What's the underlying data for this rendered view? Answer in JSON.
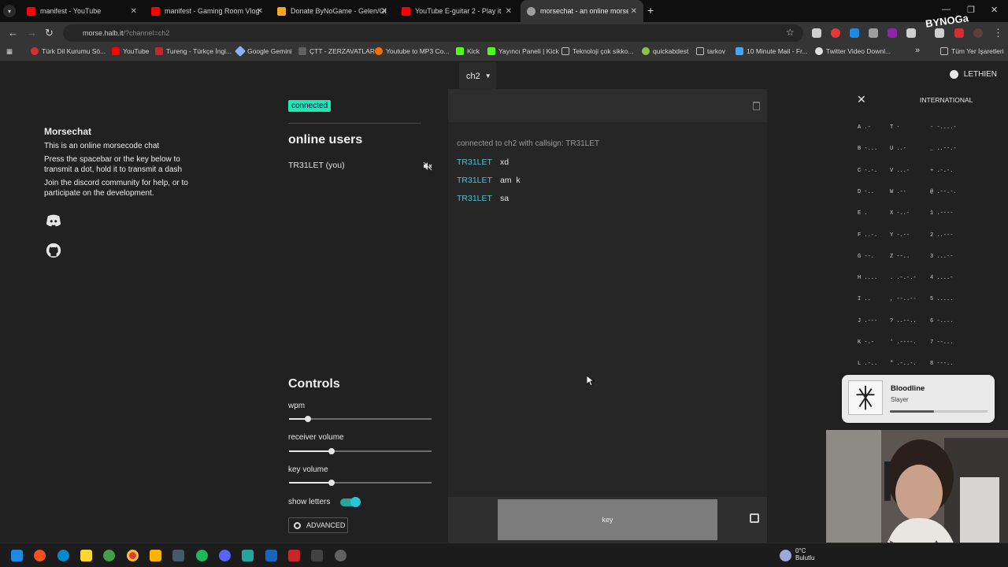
{
  "browser": {
    "tabs": [
      {
        "title": "manifest - YouTube",
        "color": "#ff0000"
      },
      {
        "title": "manifest - Gaming Room Vlog",
        "color": "#ff0000"
      },
      {
        "title": "Donate ByNoGame - Gelen/Gi",
        "color": "#f5a623"
      },
      {
        "title": "YouTube E-guitar 2 - Play it wit",
        "color": "#ff0000"
      },
      {
        "title": "morsechat - an online morse co",
        "color": "#9e9e9e"
      }
    ],
    "url_host": "morse.halb.it",
    "url_path": "/?channel=ch2",
    "bookmarks": [
      {
        "label": "Türk Dil Kurumu Sö...",
        "color": "#d32f2f"
      },
      {
        "label": "YouTube",
        "color": "#ff0000"
      },
      {
        "label": "Tureng - Türkçe İngi...",
        "color": "#c62828"
      },
      {
        "label": "Google Gemini",
        "color": "#8ab4f8"
      },
      {
        "label": "ÇTT - ZERZAVATLAR",
        "color": "#9e9e9e"
      },
      {
        "label": "Youtube to MP3 Co...",
        "color": "#ff6d00"
      },
      {
        "label": "Kick",
        "color": "#53fc18"
      },
      {
        "label": "Yayıncı Paneli | Kick",
        "color": "#53fc18"
      },
      {
        "label": "Teknoloji çok sikko...",
        "color": "#bdbdbd"
      },
      {
        "label": "quickabdest",
        "color": "#8bc34a"
      },
      {
        "label": "tarkov",
        "color": "#bdbdbd"
      },
      {
        "label": "10 Minute Mail - Fr...",
        "color": "#42a5f5"
      },
      {
        "label": "Twitter Video Downl...",
        "color": "#e0e0e0"
      }
    ],
    "bookmarks_overflow": "»",
    "all_bookmarks": "Tüm Yer İşaretleri"
  },
  "app": {
    "channel": "ch2",
    "user": "LETHIEN",
    "intro": {
      "title": "Morsechat",
      "p1": "This is an online morsecode chat",
      "p2": "Press the spacebar or the key below to transmit a dot, hold it to transmit a dash",
      "p3": "Join the discord community for help, or to participate on the development."
    },
    "status": "connected",
    "online_title": "online users",
    "online_users": [
      "TR31LET (you)"
    ],
    "controls": {
      "title": "Controls",
      "wpm_label": "wpm",
      "wpm_level": 0.13,
      "receiver_label": "receiver volume",
      "receiver_level": 0.3,
      "key_label": "key volume",
      "key_level": 0.3,
      "show_letters_label": "show letters",
      "show_letters_on": true,
      "advanced_label": "ADVANCED"
    },
    "chat": {
      "system": "connected to ch2 with callsign: TR31LET",
      "messages": [
        {
          "who": "TR31LET",
          "text": "xd"
        },
        {
          "who": "TR31LET",
          "text": "am  k"
        },
        {
          "who": "TR31LET",
          "text": "sa"
        }
      ],
      "key_label": "key"
    },
    "morse_table": {
      "title": "INTERNATIONAL",
      "col1": [
        "A .-",
        "B -...",
        "C -.-.",
        "D -..",
        "E .",
        "F ..-.",
        "G --.",
        "H ....",
        "I ..",
        "J .---",
        "K -.-",
        "L .-.."
      ],
      "col2": [
        "T -",
        "U ..-",
        "V ...-",
        "W .--",
        "X -..-",
        "Y -.--",
        "Z --..",
        ". .-.-.-",
        ", --..--",
        "? ..--..",
        "' .----.",
        "\" .-..-."
      ],
      "col3": [
        "- -....-",
        "_ ..--.-",
        "+ .-.-.",
        "@ .--.-.",
        "1 .----",
        "2 ..---",
        "3 ...--",
        "4 ....-",
        "5 .....",
        "6 -....",
        "7 --...",
        "8 ---.."
      ]
    }
  },
  "spotify": {
    "title": "Bloodline",
    "artist": "Slayer",
    "progress": 0.45
  },
  "taskbar": {
    "weather_temp": "0°C",
    "weather_desc": "Bulutlu"
  },
  "overlay": {
    "brand": "BYNOGa"
  }
}
